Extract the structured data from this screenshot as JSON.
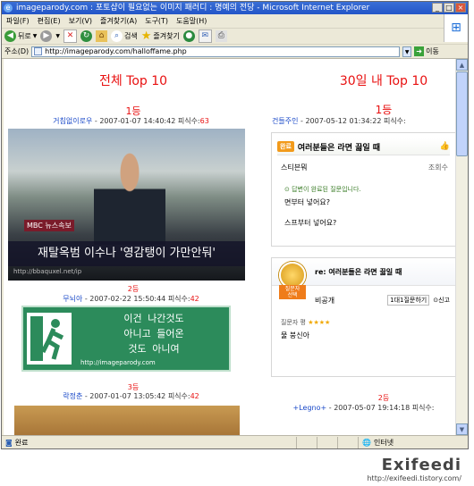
{
  "window": {
    "title": "imageparody.com : 포토샵이 필요없는 이미지 패러디 : 명예의 전당 - Microsoft Internet Explorer"
  },
  "menu": [
    "파일(F)",
    "편집(E)",
    "보기(V)",
    "즐겨찾기(A)",
    "도구(T)",
    "도움말(H)"
  ],
  "toolbar": {
    "back": "뒤로",
    "search": "검색",
    "favorites": "즐겨찾기"
  },
  "address": {
    "label": "주소(D)",
    "url": "http://imageparody.com/halloffame.php",
    "go": "이동"
  },
  "left": {
    "title": "전체 Top 10",
    "items": [
      {
        "rank": "1등",
        "nick": "거침없이로우",
        "date": "2007-01-07 14:40:42",
        "count_label": "피식수:",
        "count": "63",
        "image": {
          "badge": "MBC 뉴스속보",
          "caption": "재탈옥범 이수나 '영감탱이 가만안둬'",
          "watermark": "http://bbaquxel.net/ip"
        }
      },
      {
        "rank": "2등",
        "nick": "무뇌아",
        "date": "2007-02-22 15:50:44",
        "count_label": "피식수:",
        "count": "42",
        "image": {
          "text": "이건 나간것도\n아니고 들어온\n것도 아니여",
          "url": "http://imageparody.com"
        }
      },
      {
        "rank": "3등",
        "nick": "락정춘",
        "date": "2007-01-07 13:05:42",
        "count_label": "피식수:",
        "count": "42"
      }
    ]
  },
  "right": {
    "title": "30일 내 Top 10",
    "items": [
      {
        "rank": "1등",
        "nick": "건들주인",
        "date": "2007-05-12 01:34:22",
        "count_label": "피식수:",
        "count": "",
        "card1": {
          "badge": "완료",
          "question": "여러분들은 라면 끓일 때",
          "asker": "스티븐뭐",
          "views": "조회수",
          "answered_note": "답변이 완료된 질문입니다.",
          "q1": "면부터 넣어요?",
          "q2": "스프부터 넣어요?"
        },
        "card2": {
          "medal_line1": "질문자",
          "medal_line2": "선택",
          "question": "re: 여러분들은 라면 끓일 때",
          "private": "비공개",
          "answer_button": "1대1질문하기",
          "report": "신고",
          "rating_label": "질문자 평",
          "stars": "★★★★",
          "answer": "물 붕신아"
        }
      },
      {
        "rank": "2등",
        "nick": "+Legno+",
        "date": "2007-05-07 19:14:18",
        "count_label": "피식수:",
        "count": ""
      }
    ]
  },
  "status": {
    "done": "완료",
    "zone": "인터넷"
  },
  "watermark": {
    "brand": "Exifeedi",
    "url": "http://exifeedi.tistory.com/"
  },
  "colors": {
    "red": "#e81010",
    "blue": "#1a49c8",
    "title_bar": "#2355c8"
  }
}
